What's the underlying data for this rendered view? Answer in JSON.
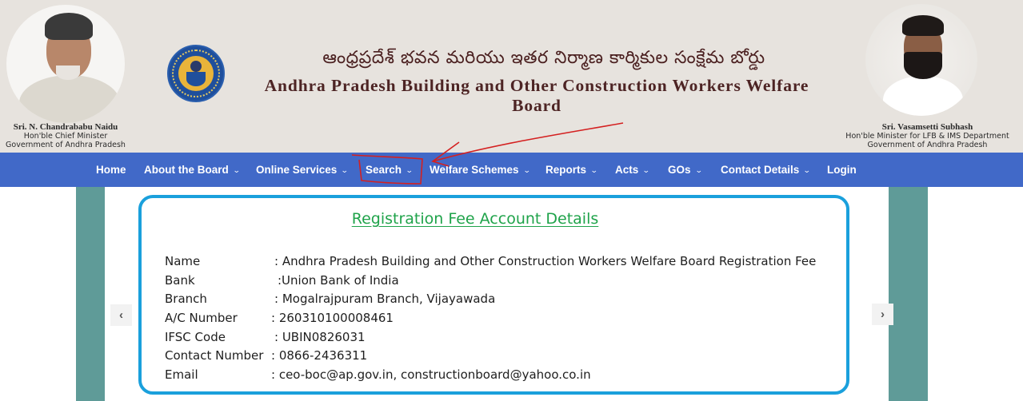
{
  "header": {
    "title_telugu": "ఆంధ్రప్రదేశ్ భవన మరియు ఇతర నిర్మాణ కార్మికుల సంక్షేమ బోర్డు",
    "title_english": "Andhra Pradesh Building and Other Construction Workers Welfare Board",
    "left_person": {
      "name": "Sri. N. Chandrababu Naidu",
      "designation": "Hon'ble Chief Minister",
      "government": "Government of Andhra Pradesh"
    },
    "right_person": {
      "name": "Sri. Vasamsetti Subhash",
      "designation": "Hon'ble Minister for LFB & IMS Department",
      "government": "Government of Andhra Pradesh"
    },
    "logo_icon": "board-emblem-logo"
  },
  "nav": {
    "items": [
      {
        "label": "Home",
        "dropdown": false
      },
      {
        "label": "About the Board",
        "dropdown": true
      },
      {
        "label": "Online Services",
        "dropdown": true
      },
      {
        "label": "Search",
        "dropdown": true
      },
      {
        "label": "Welfare Schemes",
        "dropdown": true
      },
      {
        "label": "Reports",
        "dropdown": true
      },
      {
        "label": "Acts",
        "dropdown": true
      },
      {
        "label": "GOs",
        "dropdown": true
      },
      {
        "label": "Contact Details",
        "dropdown": true
      },
      {
        "label": "Login",
        "dropdown": false
      }
    ],
    "chevron_glyph": "⌄"
  },
  "carousel": {
    "prev_glyph": "‹",
    "next_glyph": "›"
  },
  "card": {
    "title": "Registration Fee Account Details",
    "rows": [
      {
        "label": "Name",
        "value": ": Andhra Pradesh Building and Other Construction Workers Welfare Board Registration Fee"
      },
      {
        "label": "Bank",
        "value": ":Union Bank of India"
      },
      {
        "label": "Branch",
        "value": ": Mogalrajpuram Branch, Vijayawada"
      },
      {
        "label": "A/C Number",
        "value": ": 260310100008461"
      },
      {
        "label": "IFSC Code",
        "value": ":  UBIN0826031"
      },
      {
        "label": "Contact Number",
        "value": ": 0866-2436311"
      },
      {
        "label": "Email",
        "value": ": ceo-boc@ap.gov.in, constructionboard@yahoo.co.in"
      }
    ]
  },
  "colors": {
    "nav_bg": "#4169c8",
    "header_bg": "#e7e3de",
    "title_color": "#4d2424",
    "card_border": "#1aa0dc",
    "card_title": "#1fa34a",
    "side_column": "#5f9b98",
    "annotation": "#d42020"
  }
}
